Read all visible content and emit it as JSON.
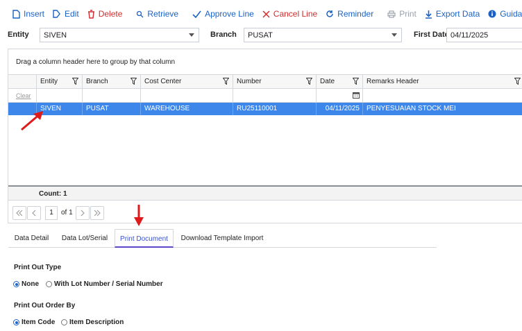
{
  "toolbar": {
    "insert": "Insert",
    "edit": "Edit",
    "delete": "Delete",
    "retrieve": "Retrieve",
    "approve_line": "Approve Line",
    "cancel_line": "Cancel Line",
    "reminder": "Reminder",
    "print": "Print",
    "export_data": "Export Data",
    "guidance": "Guidance"
  },
  "filters": {
    "entity_label": "Entity",
    "entity_value": "SIVEN",
    "branch_label": "Branch",
    "branch_value": "PUSAT",
    "first_date_label": "First Date",
    "first_date_value": "04/11/2025"
  },
  "grid": {
    "group_hint": "Drag a column header here to group by that column",
    "columns": [
      "Entity",
      "Branch",
      "Cost Center",
      "Number",
      "Date",
      "Remarks Header"
    ],
    "clear_label": "Clear",
    "rows": [
      {
        "entity": "SIVEN",
        "branch": "PUSAT",
        "cost_center": "WAREHOUSE",
        "number": "RU25110001",
        "date": "04/11/2025",
        "remarks": "PENYESUAIAN STOCK MEI"
      }
    ],
    "count_label": "Count: 1",
    "pager": {
      "page": "1",
      "of": "of 1"
    }
  },
  "tabs": [
    "Data Detail",
    "Data Lot/Serial",
    "Print Document",
    "Download Template Import"
  ],
  "active_tab": "Print Document",
  "print_out_type": {
    "title": "Print Out Type",
    "options": [
      "None",
      "With Lot Number / Serial Number"
    ],
    "selected": "None"
  },
  "print_out_order": {
    "title": "Print Out Order By",
    "options": [
      "Item Code",
      "Item Description"
    ],
    "selected": "Item Code"
  },
  "colors": {
    "accent": "#1a62c6",
    "danger": "#d22b2b",
    "selected_row": "#3d87ea",
    "active_tab_underline": "#5b46c9",
    "annotation_arrow": "#e01a1a"
  }
}
